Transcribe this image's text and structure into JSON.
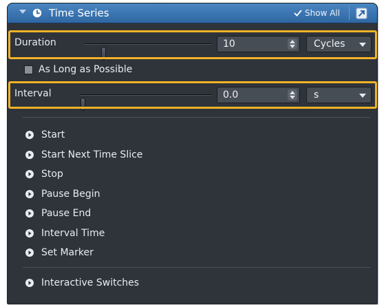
{
  "panel": {
    "title": "Time Series",
    "show_all_label": "Show All",
    "icons": {
      "collapse": "chevron-down-icon",
      "clock": "clock-icon",
      "check": "check-icon",
      "popout": "popout-icon"
    }
  },
  "duration": {
    "label": "Duration",
    "value": "10",
    "unit": "Cycles",
    "slider_level": 0.14
  },
  "as_long_as_possible": {
    "label": "As Long as Possible",
    "checked": false
  },
  "interval": {
    "label": "Interval",
    "value": "0.0",
    "unit": "s",
    "slider_level": 0.0
  },
  "triggers": [
    {
      "label": "Start"
    },
    {
      "label": "Start Next Time Slice"
    },
    {
      "label": "Stop"
    },
    {
      "label": "Pause Begin"
    },
    {
      "label": "Pause End"
    },
    {
      "label": "Interval Time"
    },
    {
      "label": "Set Marker"
    }
  ],
  "interactive_switches": {
    "label": "Interactive Switches"
  },
  "colors": {
    "header": "#3a76b4",
    "panel_bg": "#2f343b",
    "highlight": "#f2b325",
    "text": "#e8ecf2"
  }
}
